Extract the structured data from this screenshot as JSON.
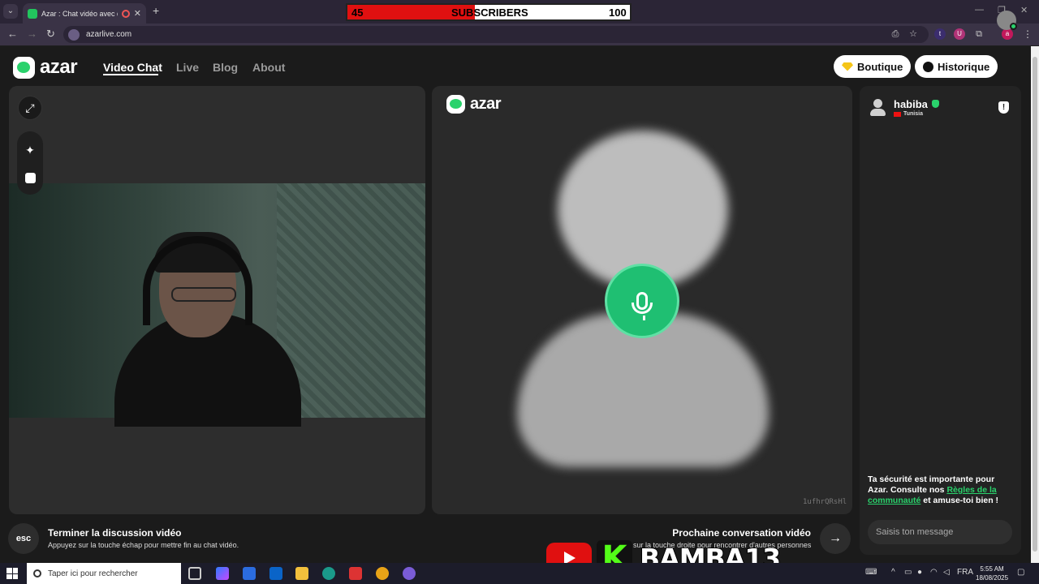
{
  "browser": {
    "tab_title": "Azar : Chat vidéo avec de n",
    "url": "azarlive.com",
    "new_tab": "+",
    "close": "✕"
  },
  "subscribers": {
    "label": "SUBSCRIBERS",
    "current": "45",
    "goal": "100",
    "progress": 0.45
  },
  "header": {
    "logo": "azar",
    "nav": [
      "Video Chat",
      "Live",
      "Blog",
      "About"
    ],
    "active_nav": "Video Chat",
    "boutique": "Boutique",
    "historique": "Historique"
  },
  "video": {
    "partner_logo": "azar",
    "peer_id": "1ufhrQRsHl"
  },
  "chat": {
    "partner_name": "habiba",
    "partner_country": "Tunisia",
    "safety_pre": "Ta sécurité est importante pour Azar. Consulte nos ",
    "safety_link": "Règles de la communauté",
    "safety_post": " et amuse-toi bien !",
    "input_placeholder": "Saisis ton message"
  },
  "bottom": {
    "esc_label": "esc",
    "end_title": "Terminer la discussion vidéo",
    "end_sub": "Appuyez sur la touche échap pour mettre fin au chat vidéo.",
    "next_title": "Prochaine conversation vidéo",
    "next_sub": "sur la touche droite pour rencontrer d'autres personnes"
  },
  "overlay": {
    "handle": "BAMBA13",
    "kick_letter": "K"
  },
  "taskbar": {
    "search_placeholder": "Taper ici pour rechercher",
    "language": "FRA",
    "time": "5:55 AM",
    "date": "18/08/2025"
  },
  "colors": {
    "accent_green": "#2ad26c",
    "subscriber_red": "#e01010",
    "mic_green": "#1fbf72"
  },
  "icons": [
    "expand-icon",
    "sparkle-icon",
    "face-filter-icon",
    "microphone-icon",
    "shield-icon",
    "arrow-right-icon",
    "diamond-icon",
    "clock-icon"
  ]
}
